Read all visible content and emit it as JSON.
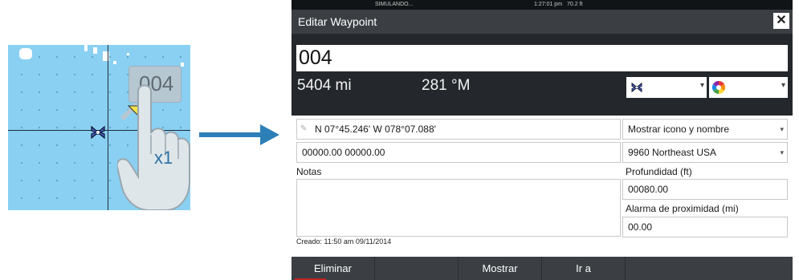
{
  "illustration": {
    "waypoint_bubble_label": "004",
    "tap_count": "x1"
  },
  "status_bar": {
    "mode": "SIMULANDO...",
    "time": "1:27:01 pm",
    "depth": "70.2 ft"
  },
  "dialog": {
    "title": "Editar Waypoint",
    "name": "004",
    "distance": "5404 mi",
    "bearing": "281 °M",
    "icon_select": "waypoint-icon",
    "color_select": "color-wheel-icon",
    "position": "N 07°45.246'   W 078°07.088'",
    "loran": "00000.00  00000.00",
    "notes_label": "Notas",
    "notes_value": "",
    "display_option": "Mostrar icono y nombre",
    "chain": "9960 Northeast USA",
    "depth_label": "Profundidad (ft)",
    "depth_value": "00080.00",
    "alarm_label": "Alarma de proximidad (mi)",
    "alarm_value": "00.00",
    "created": "Creado: 11:50 am 09/11/2014",
    "buttons": {
      "delete": "Eliminar",
      "show": "Mostrar",
      "goto": "Ir a"
    }
  },
  "colors": {
    "accent_blue": "#2d7fb8",
    "dialog_dark": "#24282c",
    "bar": "#3b3f44",
    "delete_underline": "#c02424"
  }
}
